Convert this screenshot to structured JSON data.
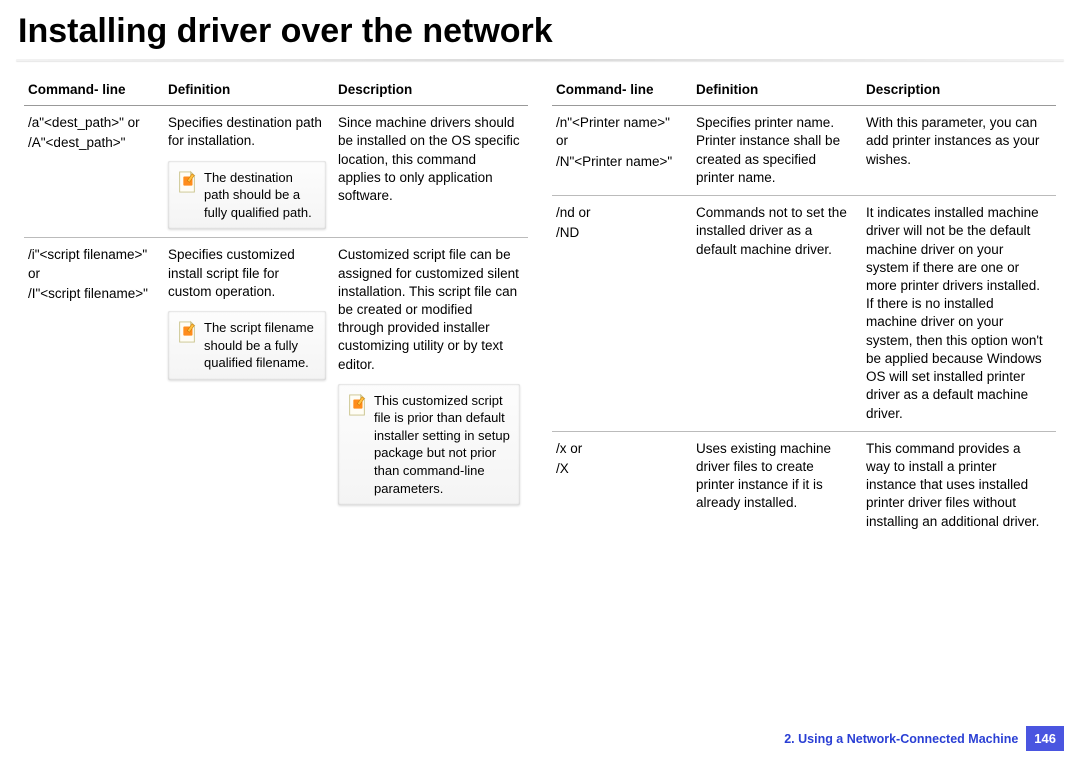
{
  "title": "Installing driver over the network",
  "headers": {
    "cmd": "Command- line",
    "def": "Definition",
    "desc": "Description"
  },
  "left_rows": [
    {
      "cmd_lines": [
        "/a\"<dest_path>\" or",
        "/A\"<dest_path>\""
      ],
      "def": "Specifies destination path for installation.",
      "note_def": "The destination path should be a fully qualified path.",
      "desc": "Since machine drivers should be installed on the OS specific location, this command applies to only application software.",
      "note_desc": null
    },
    {
      "cmd_lines": [
        "/i\"<script filename>\" or",
        "/I\"<script filename>\""
      ],
      "def": "Specifies customized install script file for custom operation.",
      "note_def": "The script filename should be a fully qualified filename.",
      "desc": "Customized script file can be assigned for customized silent installation. This script file can be created or modified through provided installer customizing utility or by text editor.",
      "note_desc": "This customized script file is prior than default installer setting in setup package but not prior than command-line parameters."
    }
  ],
  "right_rows": [
    {
      "cmd_lines": [
        "/n\"<Printer name>\" or",
        "/N\"<Printer name>\""
      ],
      "def": "Specifies printer name. Printer instance shall be created as specified printer name.",
      "desc": "With this parameter, you can add printer instances as your wishes."
    },
    {
      "cmd_lines": [
        "/nd or",
        "/ND"
      ],
      "def": "Commands not to set the installed driver as a default machine driver.",
      "desc": "It indicates installed machine driver will not be the default machine driver on your system if there are one or more printer drivers installed. If there is no installed machine driver on your system, then this option won't be applied because Windows OS will set installed printer driver as a default machine driver."
    },
    {
      "cmd_lines": [
        "/x or",
        "/X"
      ],
      "def": "Uses existing machine driver files to create printer instance if it is already installed.",
      "desc": "This command provides a way to install a printer instance that uses installed printer driver files without installing an additional driver."
    }
  ],
  "footer": {
    "chapter": "2.  Using a Network-Connected Machine",
    "page": "146"
  }
}
